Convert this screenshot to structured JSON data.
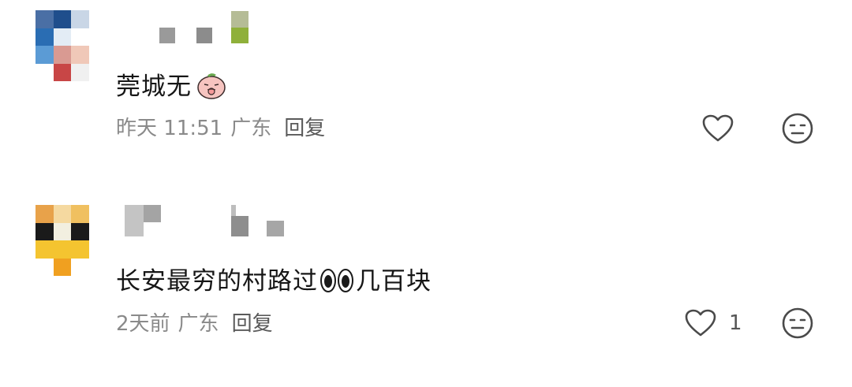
{
  "comments": [
    {
      "text": "莞城无",
      "emoji": "peach-shush-emoji",
      "time": "昨天 11:51",
      "location": "广东",
      "reply_label": "回复",
      "like_count": "",
      "avatar_colors": [
        "#4a6fa5",
        "#1f4e8c",
        "#c9d6e6",
        "#2a6db3",
        "#e3ecf5",
        "#ffffff",
        "#5b9bd5",
        "#d99a92",
        "#f0c8b8",
        "#ffffff",
        "#c84646",
        "#f0f0f0"
      ],
      "username_blocks": [
        "#9a9a9a",
        "#8c8c8c",
        "#b5bc96",
        "#8fb03a"
      ]
    },
    {
      "text_before": "长安最穷的村路过",
      "emoji": "eyes-emoji",
      "text_after": "几百块",
      "time": "2天前",
      "location": "广东",
      "reply_label": "回复",
      "like_count": "1",
      "avatar_colors": [
        "#e8a24a",
        "#f5d9a0",
        "#f0c060",
        "#1a1a1a",
        "#f2efe0",
        "#1a1a1a",
        "#f4c430",
        "#f4c430",
        "#f4c430",
        "#ffffff",
        "#f0a020",
        "#ffffff"
      ],
      "username_blocks": [
        "#c4c4c4",
        "#9e9e9e",
        "#b8b8b8",
        "#a6a6a6"
      ]
    }
  ],
  "icons": {
    "like": "heart-outline-icon",
    "dislike": "neutral-face-icon"
  },
  "colors": {
    "text": "#161616",
    "meta": "#8a8a8a",
    "icon_stroke": "#3a3a3a"
  }
}
